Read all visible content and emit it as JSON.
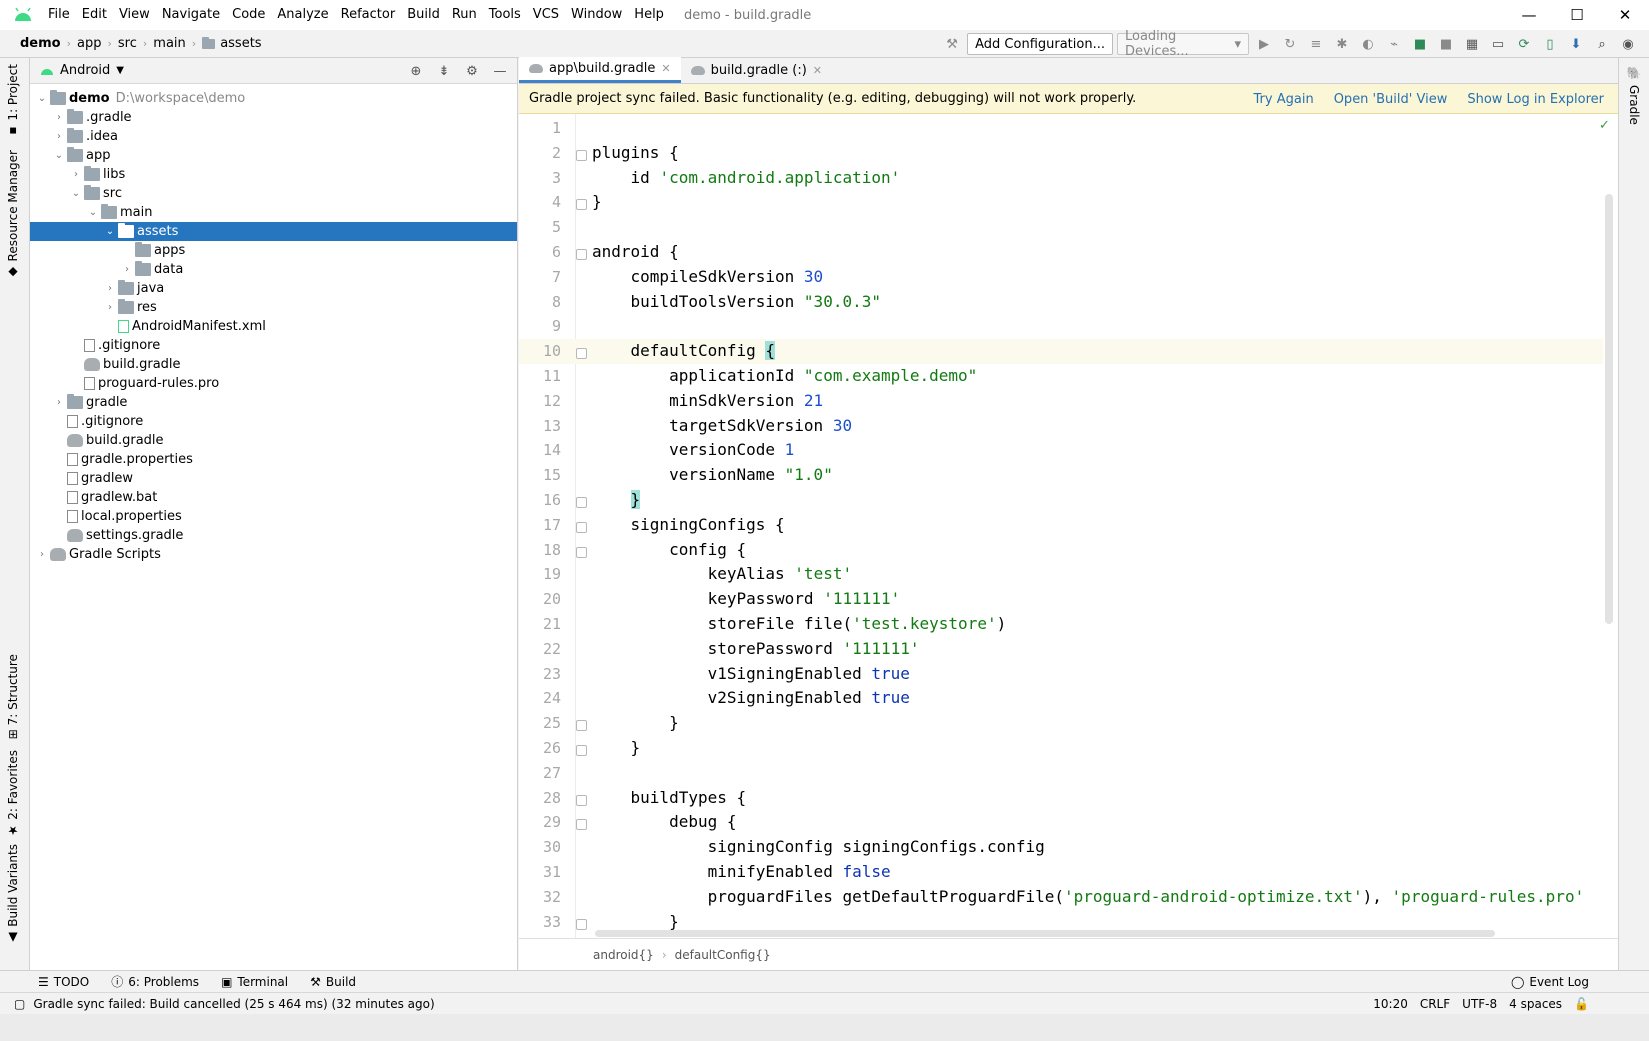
{
  "window": {
    "title": "demo - build.gradle",
    "menu": [
      "File",
      "Edit",
      "View",
      "Navigate",
      "Code",
      "Analyze",
      "Refactor",
      "Build",
      "Run",
      "Tools",
      "VCS",
      "Window",
      "Help"
    ],
    "controls": [
      "—",
      "☐",
      "✕"
    ]
  },
  "navbar": {
    "crumbs": [
      "demo",
      "app",
      "src",
      "main",
      "assets"
    ],
    "run_config": "Add Configuration...",
    "devices": "Loading Devices..."
  },
  "left_strip": {
    "project": "1: Project",
    "resource_manager": "Resource Manager",
    "structure": "7: Structure",
    "favorites": "2: Favorites",
    "build_variants": "Build Variants"
  },
  "right_strip": {
    "gradle": "Gradle"
  },
  "project_panel": {
    "view": "Android",
    "tree": [
      {
        "label": "demo",
        "hint": "D:\\workspace\\demo",
        "level": 0,
        "arrow": "open",
        "type": "module",
        "bold": true
      },
      {
        "label": ".gradle",
        "level": 1,
        "arrow": "closed",
        "type": "folder"
      },
      {
        "label": ".idea",
        "level": 1,
        "arrow": "closed",
        "type": "folder"
      },
      {
        "label": "app",
        "level": 1,
        "arrow": "open",
        "type": "folder"
      },
      {
        "label": "libs",
        "level": 2,
        "arrow": "closed",
        "type": "folder"
      },
      {
        "label": "src",
        "level": 2,
        "arrow": "open",
        "type": "folder"
      },
      {
        "label": "main",
        "level": 3,
        "arrow": "open",
        "type": "folder"
      },
      {
        "label": "assets",
        "level": 4,
        "arrow": "open",
        "type": "folder",
        "selected": true
      },
      {
        "label": "apps",
        "level": 5,
        "arrow": "none",
        "type": "folder"
      },
      {
        "label": "data",
        "level": 5,
        "arrow": "closed",
        "type": "folder"
      },
      {
        "label": "java",
        "level": 4,
        "arrow": "closed",
        "type": "folder"
      },
      {
        "label": "res",
        "level": 4,
        "arrow": "closed",
        "type": "folder"
      },
      {
        "label": "AndroidManifest.xml",
        "level": 4,
        "arrow": "none",
        "type": "manifest"
      },
      {
        "label": ".gitignore",
        "level": 2,
        "arrow": "none",
        "type": "file"
      },
      {
        "label": "build.gradle",
        "level": 2,
        "arrow": "none",
        "type": "gradle"
      },
      {
        "label": "proguard-rules.pro",
        "level": 2,
        "arrow": "none",
        "type": "file"
      },
      {
        "label": "gradle",
        "level": 1,
        "arrow": "closed",
        "type": "folder"
      },
      {
        "label": ".gitignore",
        "level": 1,
        "arrow": "none",
        "type": "file"
      },
      {
        "label": "build.gradle",
        "level": 1,
        "arrow": "none",
        "type": "gradle"
      },
      {
        "label": "gradle.properties",
        "level": 1,
        "arrow": "none",
        "type": "file"
      },
      {
        "label": "gradlew",
        "level": 1,
        "arrow": "none",
        "type": "file"
      },
      {
        "label": "gradlew.bat",
        "level": 1,
        "arrow": "none",
        "type": "file"
      },
      {
        "label": "local.properties",
        "level": 1,
        "arrow": "none",
        "type": "file"
      },
      {
        "label": "settings.gradle",
        "level": 1,
        "arrow": "none",
        "type": "gradle"
      },
      {
        "label": "Gradle Scripts",
        "level": 0,
        "arrow": "closed",
        "type": "gradle"
      }
    ]
  },
  "editor": {
    "tabs": [
      {
        "label": "app\\build.gradle",
        "active": true
      },
      {
        "label": "build.gradle (:)",
        "active": false
      }
    ],
    "banner": {
      "message": "Gradle project sync failed. Basic functionality (e.g. editing, debugging) will not work properly.",
      "actions": [
        "Try Again",
        "Open 'Build' View",
        "Show Log in Explorer"
      ]
    },
    "current_line": 10,
    "lines": [
      "",
      "plugins {",
      "    id 'com.android.application'",
      "}",
      "",
      "android {",
      "    compileSdkVersion 30",
      "    buildToolsVersion \"30.0.3\"",
      "",
      "    defaultConfig {",
      "        applicationId \"com.example.demo\"",
      "        minSdkVersion 21",
      "        targetSdkVersion 30",
      "        versionCode 1",
      "        versionName \"1.0\"",
      "    }",
      "    signingConfigs {",
      "        config {",
      "            keyAlias 'test'",
      "            keyPassword '111111'",
      "            storeFile file('test.keystore')",
      "            storePassword '111111'",
      "            v1SigningEnabled true",
      "            v2SigningEnabled true",
      "        }",
      "    }",
      "",
      "    buildTypes {",
      "        debug {",
      "            signingConfig signingConfigs.config",
      "            minifyEnabled false",
      "            proguardFiles getDefaultProguardFile('proguard-android-optimize.txt'), 'proguard-rules.pro'",
      "        }"
    ],
    "breadcrumb": [
      "android{}",
      "defaultConfig{}"
    ]
  },
  "bottom_tools": [
    "TODO",
    "6: Problems",
    "Terminal",
    "Build"
  ],
  "event_log": "Event Log",
  "status": {
    "message": "Gradle sync failed: Build cancelled (25 s 464 ms) (32 minutes ago)",
    "position": "10:20",
    "line_sep": "CRLF",
    "encoding": "UTF-8",
    "indent": "4 spaces"
  },
  "colors": {
    "selection": "#2675bf",
    "banner": "#fbf6d6",
    "link": "#2470b3",
    "string": "#127a12",
    "number": "#1d4ed0",
    "keyword": "#0b33b3"
  }
}
